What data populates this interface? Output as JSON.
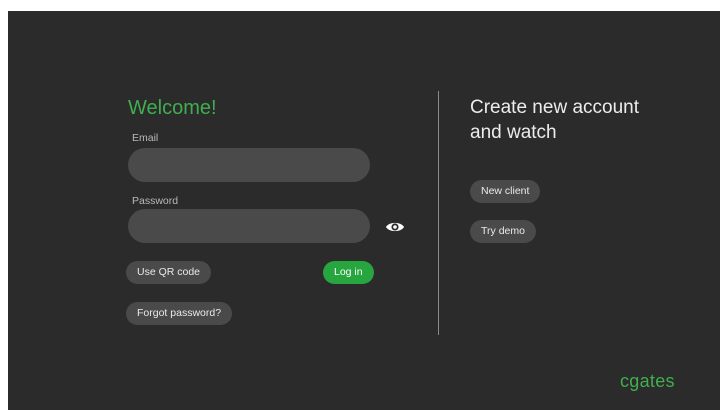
{
  "login": {
    "title": "Welcome!",
    "email_label": "Email",
    "email_value": "",
    "password_label": "Password",
    "password_value": "",
    "show_password_icon": "eye-icon",
    "qr_button": "Use QR code",
    "login_button": "Log in",
    "forgot_button": "Forgot password?"
  },
  "signup": {
    "title_line1": "Create new account",
    "title_line2": "and watch",
    "new_client_button": "New client",
    "try_demo_button": "Try demo"
  },
  "brand": {
    "logo_text": "cgates"
  },
  "colors": {
    "background": "#2b2b2b",
    "accent": "#27a53f",
    "accent_text": "#3fae4f",
    "control": "#4a4a4a"
  }
}
